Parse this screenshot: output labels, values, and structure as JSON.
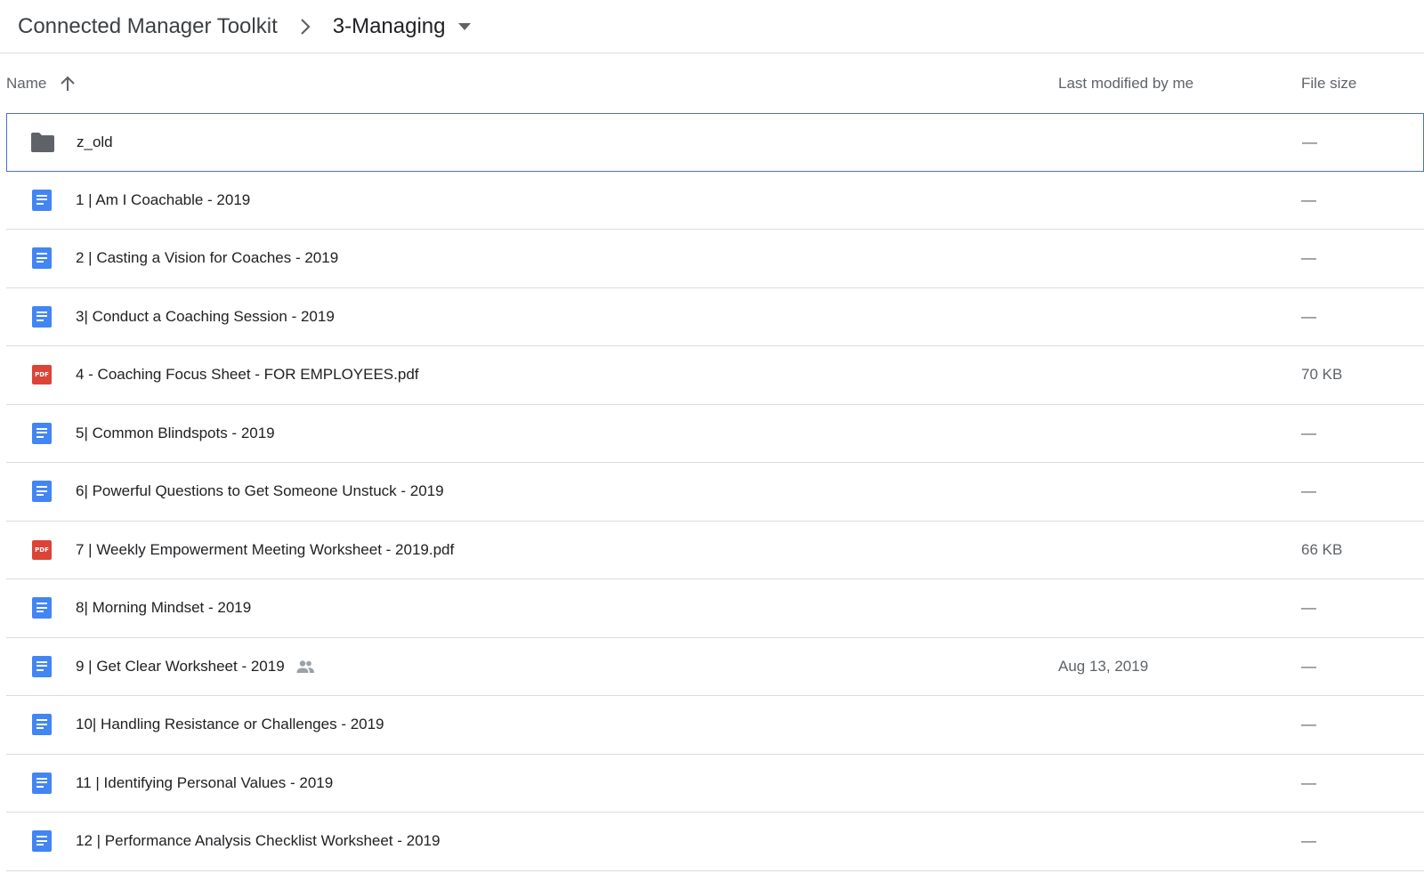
{
  "breadcrumb": {
    "root": "Connected Manager Toolkit",
    "current": "3-Managing"
  },
  "columns": {
    "name": "Name",
    "modified": "Last modified by me",
    "size": "File size"
  },
  "colors": {
    "doc_blue": "#4285f4",
    "pdf_red": "#db4437",
    "folder_gray": "#5f6368",
    "selection_border": "#4a6fd4"
  },
  "files": [
    {
      "icon": "folder-icon",
      "name": "z_old",
      "modified": "",
      "size": "—"
    },
    {
      "icon": "doc-icon",
      "name": "1 | Am I Coachable - 2019",
      "modified": "",
      "size": "—"
    },
    {
      "icon": "doc-icon",
      "name": "2 | Casting a Vision for Coaches - 2019",
      "modified": "",
      "size": "—"
    },
    {
      "icon": "doc-icon",
      "name": "3| Conduct a Coaching Session - 2019",
      "modified": "",
      "size": "—"
    },
    {
      "icon": "pdf-icon",
      "icon_text": "PDF",
      "name": "4 - Coaching Focus Sheet - FOR EMPLOYEES.pdf",
      "modified": "",
      "size": "70 KB"
    },
    {
      "icon": "doc-icon",
      "name": "5| Common Blindspots - 2019",
      "modified": "",
      "size": "—"
    },
    {
      "icon": "doc-icon",
      "name": "6| Powerful Questions to Get Someone Unstuck - 2019",
      "modified": "",
      "size": "—"
    },
    {
      "icon": "pdf-icon",
      "icon_text": "PDF",
      "name": "7 | Weekly Empowerment Meeting Worksheet - 2019.pdf",
      "modified": "",
      "size": "66 KB"
    },
    {
      "icon": "doc-icon",
      "name": "8| Morning Mindset - 2019",
      "modified": "",
      "size": "—"
    },
    {
      "icon": "doc-icon",
      "name": "9 | Get Clear Worksheet - 2019",
      "shared": true,
      "modified": "Aug 13, 2019",
      "size": "—"
    },
    {
      "icon": "doc-icon",
      "name": "10| Handling Resistance or Challenges - 2019",
      "modified": "",
      "size": "—"
    },
    {
      "icon": "doc-icon",
      "name": "11 | Identifying Personal Values - 2019",
      "modified": "",
      "size": "—"
    },
    {
      "icon": "doc-icon",
      "name": "12 | Performance Analysis Checklist Worksheet - 2019",
      "modified": "",
      "size": "—"
    }
  ]
}
